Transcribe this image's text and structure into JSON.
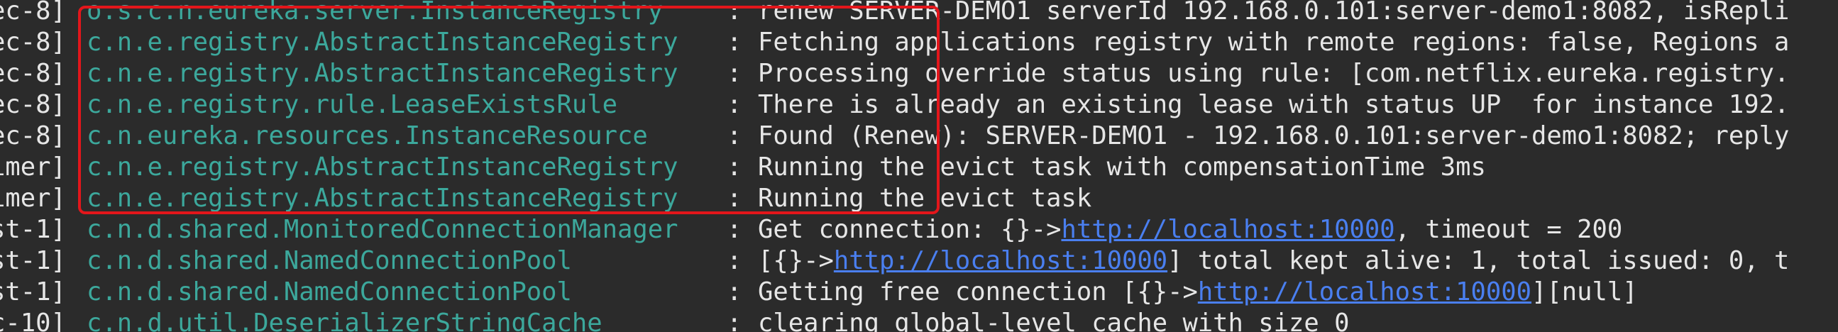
{
  "log_lines": [
    {
      "thread": "ec-8]",
      "logger": "o.s.c.n.eureka.server.InstanceRegistry",
      "message": "renew SERVER-DEMO1 serverId 192.168.0.101:server-demo1:8082, isRepli"
    },
    {
      "thread": "ec-8]",
      "logger": "c.n.e.registry.AbstractInstanceRegistry",
      "message": "Fetching applications registry with remote regions: false, Regions a"
    },
    {
      "thread": "ec-8]",
      "logger": "c.n.e.registry.AbstractInstanceRegistry",
      "message": "Processing override status using rule: [com.netflix.eureka.registry."
    },
    {
      "thread": "ec-8]",
      "logger": "c.n.e.registry.rule.LeaseExistsRule",
      "message": "There is already an existing lease with status UP  for instance 192."
    },
    {
      "thread": "ec-8]",
      "logger": "c.n.eureka.resources.InstanceResource",
      "message": "Found (Renew): SERVER-DEMO1 - 192.168.0.101:server-demo1:8082; reply"
    },
    {
      "thread": "imer]",
      "logger": "c.n.e.registry.AbstractInstanceRegistry",
      "message": "Running the evict task with compensationTime 3ms"
    },
    {
      "thread": "imer]",
      "logger": "c.n.e.registry.AbstractInstanceRegistry",
      "message": "Running the evict task"
    },
    {
      "thread": "st-1]",
      "logger": "c.n.d.shared.MonitoredConnectionManager",
      "msg_pre": "Get connection: {}->",
      "link": "http://localhost:10000",
      "msg_post": ", timeout = 200"
    },
    {
      "thread": "st-1]",
      "logger": "c.n.d.shared.NamedConnectionPool",
      "msg_pre": "[{}->",
      "link": "http://localhost:10000",
      "msg_post": "] total kept alive: 1, total issued: 0, t"
    },
    {
      "thread": "st-1]",
      "logger": "c.n.d.shared.NamedConnectionPool",
      "msg_pre": "Getting free connection [{}->",
      "link": "http://localhost:10000",
      "msg_post": "][null]"
    },
    {
      "thread": "c-10]",
      "logger": "c.n.d.util.DeserializerStringCache",
      "message": "clearing global-level cache with size 0"
    }
  ],
  "separator": ":",
  "colors": {
    "background": "#2b2b2b",
    "text": "#e6e6e6",
    "logger": "#3ca89c",
    "link": "#4a7ff0",
    "highlight_border": "#e3161b"
  }
}
